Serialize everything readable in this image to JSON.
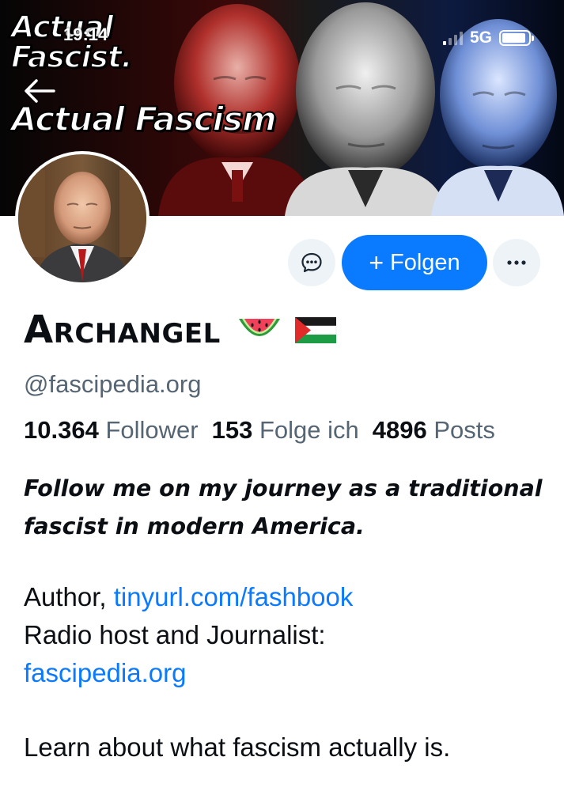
{
  "status_bar": {
    "time": "19:14",
    "network": "5G",
    "battery_level": 0.9
  },
  "banner": {
    "line1": "Actual",
    "line2": "Fascist.",
    "line3": "Actual Fascism"
  },
  "actions": {
    "follow_label": "Folgen",
    "follow_plus": "+"
  },
  "profile": {
    "display_name": "Archangel",
    "emojis": [
      "watermelon-emoji",
      "palestine-flag-emoji"
    ],
    "handle": "@fascipedia.org"
  },
  "stats": [
    {
      "value": "10.364",
      "label": "Follower"
    },
    {
      "value": "153",
      "label": "Folge ich"
    },
    {
      "value": "4896",
      "label": "Posts"
    }
  ],
  "bio": {
    "lead_line1": "Follow me on my  journey as a traditional",
    "lead_line2": "fascist in modern America.",
    "author_prefix": "Author, ",
    "author_link": "tinyurl.com/fashbook",
    "radio": "Radio host and Journalist:",
    "radio_link": "fascipedia.org",
    "learn": "Learn about what fascism actually is."
  },
  "icons": {
    "back": "arrow-left-icon",
    "message": "chat-bubble-icon",
    "more": "more-horizontal-icon"
  },
  "colors": {
    "accent": "#0a7aff",
    "muted_text": "#566573",
    "button_bg": "#eef3f7"
  }
}
